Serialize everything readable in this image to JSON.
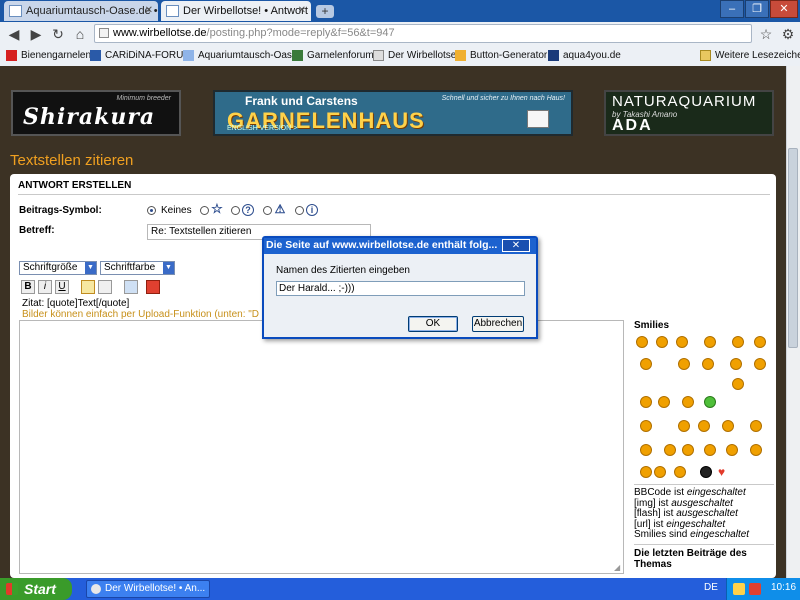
{
  "browser": {
    "tabs": [
      {
        "label": "Aquariumtausch-Oase.de •..."
      },
      {
        "label": "Der Wirbellotse! • Antwort ..."
      }
    ],
    "url_host": "www.wirbellotse.de",
    "url_path": "/posting.php?mode=reply&f=56&t=947",
    "window_buttons": {
      "minimize": "–",
      "maximize": "❐",
      "close": "✕"
    },
    "bookmarks": [
      {
        "label": "Bienengarnelen"
      },
      {
        "label": "CARiDiNA-FORUM"
      },
      {
        "label": "Aquariumtausch-Oase"
      },
      {
        "label": "Garnelenforum"
      },
      {
        "label": "Der Wirbellotse"
      },
      {
        "label": "Button-Generator"
      },
      {
        "label": "aqua4you.de"
      }
    ],
    "other_bookmarks": "Weitere Lesezeichen"
  },
  "banners": {
    "shirakura": {
      "logo": "Shirakura",
      "tagline": "Minimum breeder"
    },
    "garnelenhaus": {
      "line1": "Frank und Carstens",
      "line2": "GARNELENHAUS",
      "note": "Schnell und sicher zu Ihnen nach Haus!",
      "footer": "ENGLISH VERSION >"
    },
    "ada": {
      "line1": "NATURAQUARIUM",
      "line2": "by Takashi Amano",
      "line3": "ADA"
    }
  },
  "page": {
    "title": "Textstellen zitieren",
    "section_header": "ANTWORT ERSTELLEN",
    "icon_label": "Beitrags-Symbol:",
    "icon_none": "Keines",
    "subject_label": "Betreff:",
    "subject_value": "Re: Textstellen zitieren",
    "font_size_select": "Schriftgröße",
    "font_color_select": "Schriftfarbe",
    "format_buttons": {
      "bold": "B",
      "italic": "i",
      "underline": "U"
    },
    "quote_hint": "Zitat: [quote]Text[/quote]",
    "upload_hint": "Bilder können einfach per Upload-Funktion (unten: \"D",
    "smilies_title": "Smilies",
    "bbcode_info": [
      {
        "prefix": "BBCode ist ",
        "state": "eingeschaltet"
      },
      {
        "prefix": "[img] ist ",
        "state": "ausgeschaltet"
      },
      {
        "prefix": "[flash] ist ",
        "state": "ausgeschaltet"
      },
      {
        "prefix": "[url] ist ",
        "state": "eingeschaltet"
      },
      {
        "prefix": "Smilies sind ",
        "state": "eingeschaltet"
      }
    ],
    "recent_posts_title": "Die letzten Beiträge des Themas"
  },
  "dialog": {
    "title": "Die Seite auf www.wirbellotse.de enthält folg...",
    "prompt": "Namen des Zitierten eingeben",
    "input_value": "Der Harald... ;-)))",
    "ok_label": "OK",
    "cancel_label": "Abbrechen",
    "close_glyph": "✕"
  },
  "taskbar": {
    "start_label": "Start",
    "task_label": "Der Wirbellotse! • An...",
    "language": "DE",
    "clock": "10:16"
  },
  "colors": {
    "page_bg": "#3c3224",
    "title_orange": "#f0a020",
    "dialog_blue": "#1c62cf",
    "taskbar_blue": "#245edb"
  }
}
